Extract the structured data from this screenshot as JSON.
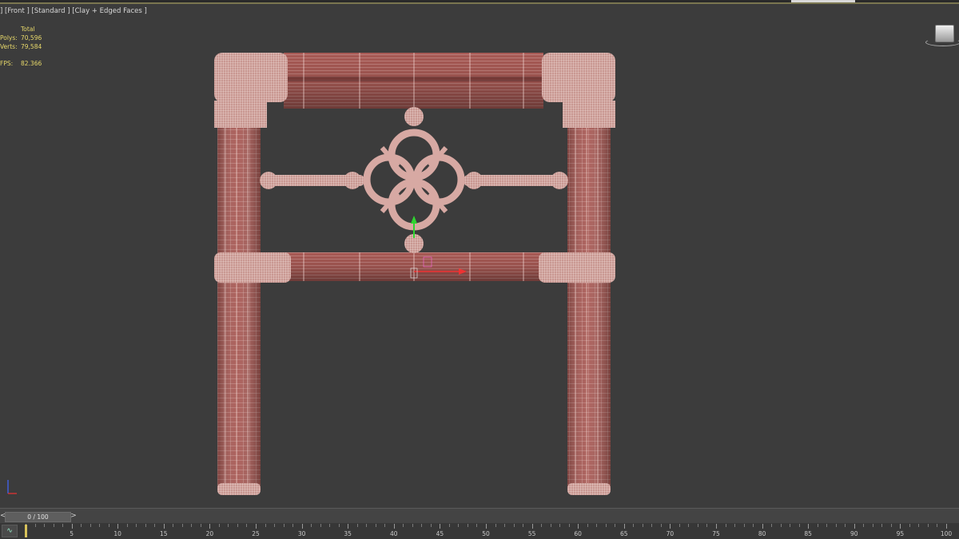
{
  "viewport": {
    "label": "] [Front ] [Standard ] [Clay + Edged Faces ]",
    "stats": {
      "header": "Total",
      "polys_label": "Polys:",
      "polys_value": "70,596",
      "verts_label": "Verts:",
      "verts_value": "79,584",
      "fps_label": "FPS:",
      "fps_value": "82.366"
    },
    "colors": {
      "background": "#3c3c3c",
      "mesh": "#a85a55",
      "wire": "#f2d6d2"
    }
  },
  "timebar": {
    "prev": "<",
    "slider_value": "0 / 100",
    "next": ">"
  },
  "trackbar": {
    "labels": [
      "5",
      "10",
      "15",
      "20",
      "25",
      "30",
      "35",
      "40",
      "45",
      "50",
      "55",
      "60",
      "65",
      "70",
      "75",
      "80",
      "85",
      "90",
      "95",
      "100"
    ],
    "current_frame": 0,
    "total_frames": 100
  }
}
